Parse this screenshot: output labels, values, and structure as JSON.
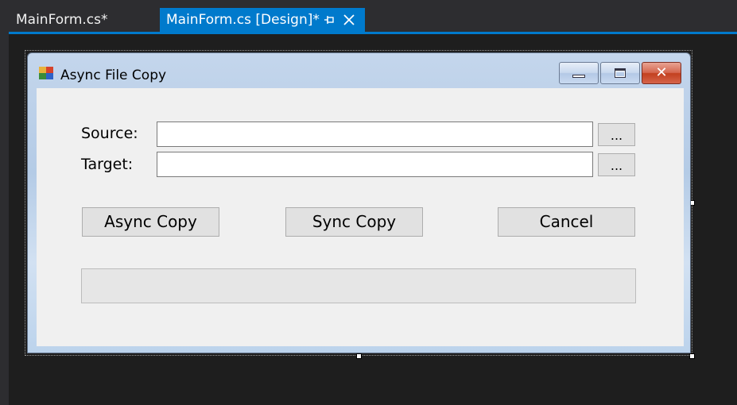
{
  "tabs": [
    {
      "label": "MainForm.cs*",
      "active": false
    },
    {
      "label": "MainForm.cs [Design]*",
      "active": true
    }
  ],
  "tab_pin_icon": "pin-icon",
  "tab_close_icon": "close-icon",
  "colors": {
    "ide_background": "#1e1e1e",
    "tab_active": "#007acc",
    "form_client": "#f0f0f0"
  },
  "form": {
    "title": "Async File Copy",
    "close_glyph": "✕",
    "source_label": "Source:",
    "target_label": "Target:",
    "source_browse": "...",
    "target_browse": "...",
    "source_value": "",
    "target_value": "",
    "async_copy": "Async Copy",
    "sync_copy": "Sync Copy",
    "cancel": "Cancel",
    "progress": 0
  }
}
